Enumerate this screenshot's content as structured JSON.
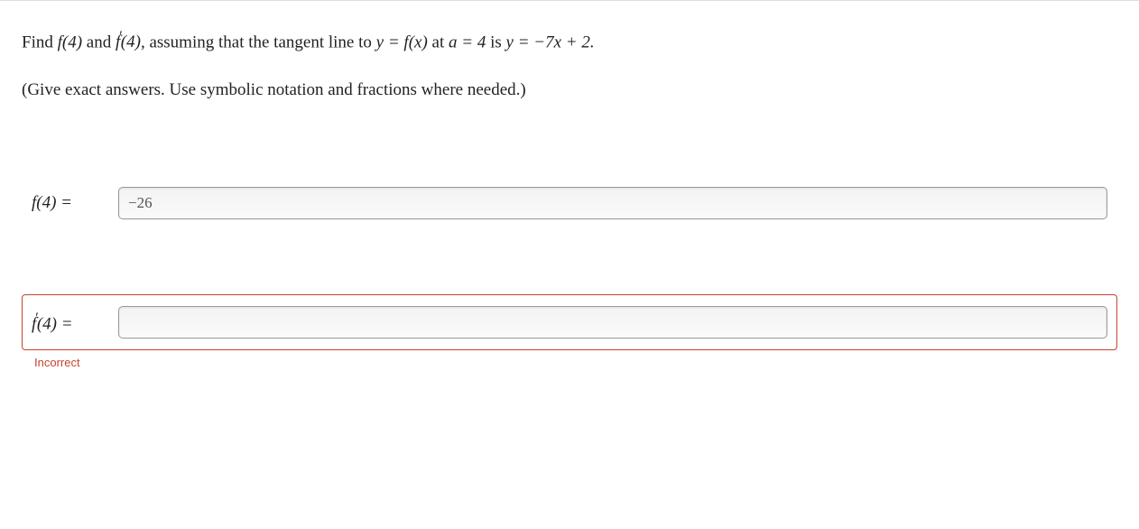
{
  "question": {
    "text_prefix": "Find ",
    "f4": "f(4)",
    "and": " and ",
    "fprime4": "f′(4)",
    "middle": ", assuming that the tangent line to ",
    "y_eq": "y = f(x)",
    "at": " at ",
    "a_eq": "a = 4",
    "is": " is ",
    "tangent": "y = −7x + 2.",
    "instruction": "(Give exact answers. Use symbolic notation and fractions where needed.)"
  },
  "answers": {
    "first": {
      "label_f": "f",
      "label_arg": "(4) =",
      "value": "−26"
    },
    "second": {
      "label_f": "f",
      "label_prime": "′",
      "label_arg": "(4) =",
      "value": ""
    }
  },
  "feedback": {
    "incorrect": "Incorrect"
  }
}
